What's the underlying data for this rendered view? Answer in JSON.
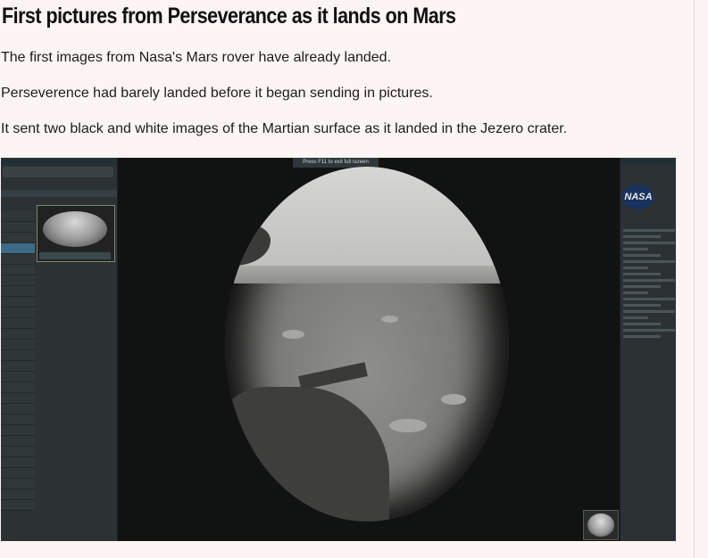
{
  "article": {
    "headline": "First pictures from Perseverance as it lands on Mars",
    "paragraphs": [
      "The first images from Nasa's Mars rover have already landed.",
      "Perseverence had barely landed before it began sending in pictures.",
      "It sent two black and white images of the Martian surface as it landed in the Jezero crater."
    ]
  },
  "photo": {
    "fullscreen_hint": "Press F11 to exit full screen",
    "logo_text": "NASA"
  }
}
